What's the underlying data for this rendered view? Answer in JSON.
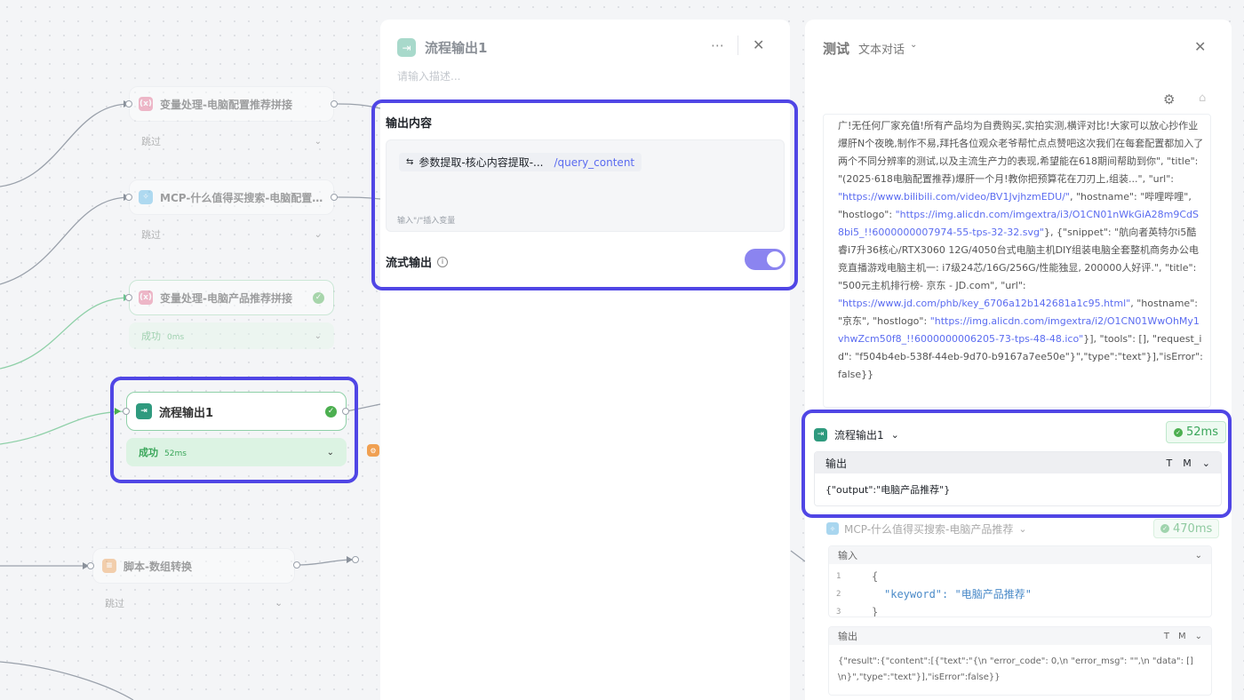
{
  "workflow": {
    "nodes": [
      {
        "title": "变量处理-电脑配置推荐拼接",
        "status": "跳过"
      },
      {
        "title": "MCP-什么值得买搜索-电脑配置推...",
        "status": "跳过"
      },
      {
        "title": "变量处理-电脑产品推荐拼接",
        "status": "成功",
        "time": "0ms"
      },
      {
        "title": "流程输出1",
        "status": "成功",
        "time": "52ms"
      },
      {
        "title": "脚本-数组转换",
        "status": "跳过"
      }
    ]
  },
  "node_panel": {
    "title": "流程输出1",
    "description_placeholder": "请输入描述...",
    "output_section_label": "输出内容",
    "variable_chip": "参数提取-核心内容提取-...",
    "variable_path": "/query_content",
    "insert_hint": "输入\"/\"插入变量",
    "streaming_label": "流式输出",
    "streaming_enabled": true
  },
  "test_panel": {
    "title": "测试",
    "mode": "文本对话",
    "log_text_before_1": "广!无任何厂家充值!所有产品均为自费购买,实拍实测,横评对比!大家可以放心抄作业爆肝N个夜晚,制作不易,拜托各位观众老爷帮忙点点赞吧这次我们在每套配置都加入了两个不同分辨率的测试,以及主流生产力的表现,希望能在618期间帮助到你\", \"title\": \"(2025·618电脑配置推荐)爆肝一个月!教你把预算花在刀刃上,组装...\",",
    "log_url_label": "\"url\": ",
    "log_url_1": "\"https://www.bilibili.com/video/BV1JvjhzmEDU/\"",
    "log_text_after_url_1": ", \"hostname\": \"哔哩哔哩\", \"hostlogo\":",
    "log_url_2": "\"https://img.alicdn.com/imgextra/i3/O1CN01nWkGiA28m9CdS8bi5_!!6000000007974-55-tps-32-32.svg\"",
    "log_text_2": "}, {\"snippet\": \"航向者英特尔i5酷睿i7升36核心/RTX3060 12G/4050台式电脑主机DIY组装电脑全套整机商务办公电竞直播游戏电脑主机一: i7级24芯/16G/256G/性能独显, 200000人好评.\", \"title\": \"500元主机排行榜- 京东 - JD.com\", \"url\":",
    "log_url_3": "\"https://www.jd.com/phb/key_6706a12b142681a1c95.html\"",
    "log_text_3": ", \"hostname\": \"京东\", \"hostlogo\":",
    "log_url_4": "\"https://img.alicdn.com/imgextra/i2/O1CN01WwOhMy1vhwZcm50f8_!!6000000006205-73-tps-48-48.ico\"",
    "log_text_4": "}], \"tools\": [], \"request_id\": \"f504b4eb-538f-44eb-9d70-b9167a7ee50e\"}\",\"type\":\"text\"}],\"isError\":false}}",
    "result_block": {
      "title": "流程输出1",
      "time": "52ms",
      "output_label": "输出",
      "fmt_t": "T",
      "fmt_m": "M",
      "output_value": "{\"output\":\"电脑产品推荐\"}"
    },
    "mcp_block": {
      "title": "MCP-什么值得买搜索-电脑产品推荐",
      "time": "470ms",
      "input_label": "输入",
      "code_lines": [
        {
          "no": "1",
          "text": "{"
        },
        {
          "no": "2",
          "text": "\"keyword\": \"电脑产品推荐\""
        },
        {
          "no": "3",
          "text": "}"
        }
      ],
      "output_label": "输出",
      "fmt_t": "T",
      "fmt_m": "M",
      "output_value": "{\"result\":{\"content\":[{\"text\":\"{\\n \"error_code\": 0,\\n \"error_msg\": \"\",\\n \"data\": []\\n}\",\"type\":\"text\"}],\"isError\":false}}"
    }
  },
  "colors": {
    "accent": "#5046e5",
    "success": "#4caf50",
    "toggle": "#8b84f0",
    "link": "#5b6cf0"
  }
}
